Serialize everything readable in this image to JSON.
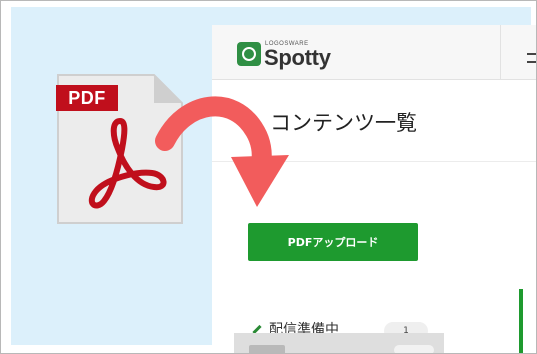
{
  "brand": {
    "logo_small": "LOGOSWARE",
    "logo_name": "Spotty"
  },
  "page": {
    "title": "コンテンツ一覧"
  },
  "toolbar": {
    "upload_label": "PDFアップロード"
  },
  "sidebar": {
    "status_label": "配信準備中",
    "status_count": "1"
  },
  "file_icon": {
    "label": "PDF"
  },
  "colors": {
    "accent_green": "#1e9a2f",
    "pdf_red": "#c00f1c",
    "arrow_coral": "#f25c5c",
    "background_blue": "#dcf0fb"
  },
  "icons": [
    "spotty-logo-icon",
    "menu-icon",
    "pdf-file-icon",
    "acrobat-icon",
    "curved-arrow-icon",
    "pencil-icon"
  ]
}
